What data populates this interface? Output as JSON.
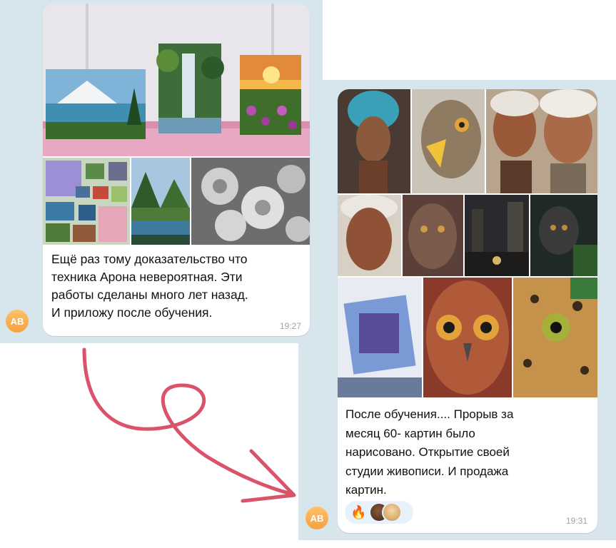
{
  "message_one": {
    "avatar": "AB",
    "text_lines": [
      "Ещё раз тому доказательство  что",
      "техника Арона невероятная. Эти",
      "работы сделаны много лет назад.",
      "И приложу после обучения."
    ],
    "time": "19:27"
  },
  "message_two": {
    "avatar": "AB",
    "text_lines": [
      "После обучения.... Прорыв за",
      "месяц 60- картин было",
      "нарисовано. Открытие своей",
      "студии живописи. И продажа",
      "картин."
    ],
    "time": "19:31",
    "reactions": {
      "emoji": "🔥"
    }
  },
  "colors": {
    "chat_background": "#d7e6ec",
    "bubble": "#ffffff",
    "avatar": "#f5a33c",
    "arrow": "#d9546a"
  }
}
